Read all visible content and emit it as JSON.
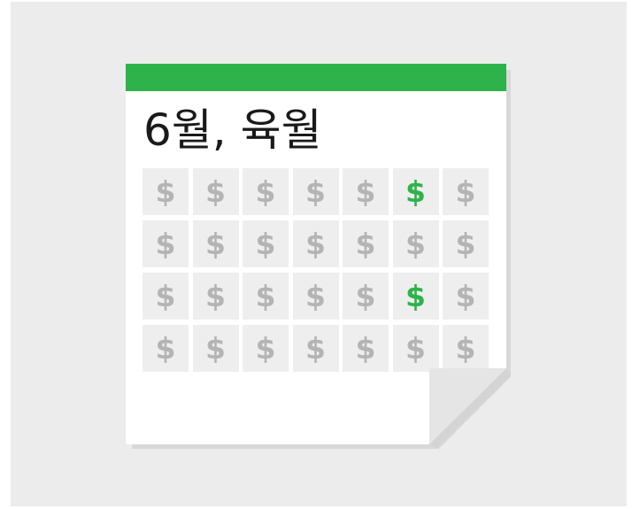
{
  "calendar": {
    "title": "6월, 육월",
    "symbol": "$",
    "rows": 4,
    "columns": 7,
    "highlighted_cells": [
      [
        0,
        5
      ],
      [
        2,
        5
      ]
    ]
  },
  "colors": {
    "accent": "#2db34a",
    "symbol_default": "#b4b4b4",
    "cell_background": "#eeeeee",
    "page_background": "#ececec"
  },
  "icons": {
    "cell_icon": "dollar-sign-icon",
    "corner": "page-curl-icon"
  }
}
